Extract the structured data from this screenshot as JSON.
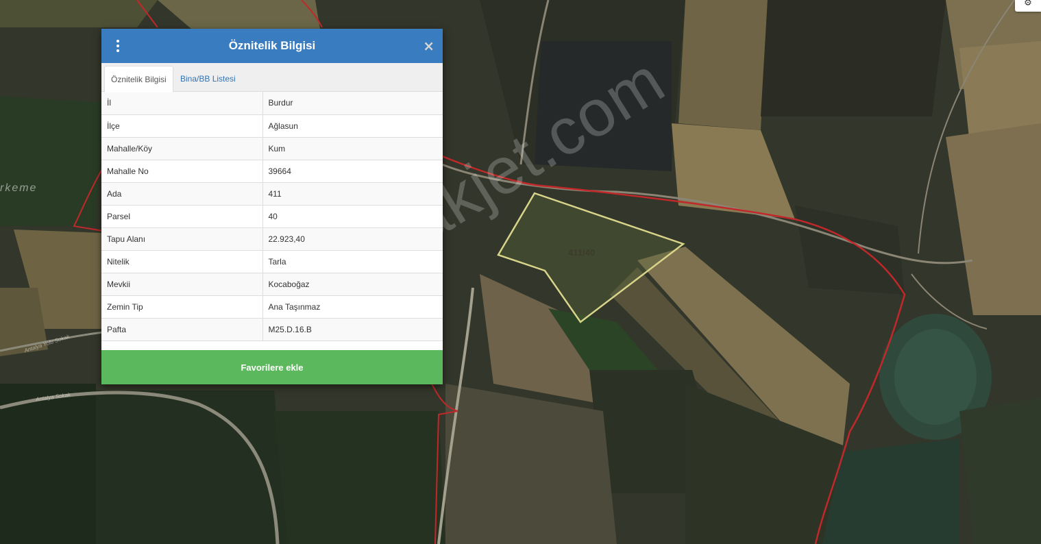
{
  "map": {
    "parcel_label": "411/40",
    "watermark": "emlakjet.com",
    "place_label": "rkeme",
    "street_labels": [
      "Antalya Yolu Sokak",
      "Antalya Sokak"
    ],
    "colors": {
      "boundary": "#c0282a",
      "parcel_outline": "#d8d58a"
    }
  },
  "settings": {
    "icon": "gear-icon"
  },
  "panel": {
    "title": "Öznitelik Bilgisi",
    "menu_icon": "kebab-menu-icon",
    "close_icon": "close-icon",
    "tabs": [
      {
        "label": "Öznitelik Bilgisi",
        "active": true
      },
      {
        "label": "Bina/BB Listesi",
        "active": false
      }
    ],
    "rows": [
      {
        "key": "İl",
        "value": "Burdur"
      },
      {
        "key": "İlçe",
        "value": "Ağlasun"
      },
      {
        "key": "Mahalle/Köy",
        "value": "Kum"
      },
      {
        "key": "Mahalle No",
        "value": "39664"
      },
      {
        "key": "Ada",
        "value": "411"
      },
      {
        "key": "Parsel",
        "value": "40"
      },
      {
        "key": "Tapu Alanı",
        "value": "22.923,40"
      },
      {
        "key": "Nitelik",
        "value": "Tarla"
      },
      {
        "key": "Mevkii",
        "value": "Kocaboğaz"
      },
      {
        "key": "Zemin Tip",
        "value": "Ana Taşınmaz"
      },
      {
        "key": "Pafta",
        "value": "M25.D.16.B"
      }
    ],
    "favorite_button": "Favorilere ekle",
    "colors": {
      "header": "#3a7cc0",
      "button": "#5cb85c",
      "link": "#2f72b5"
    }
  }
}
